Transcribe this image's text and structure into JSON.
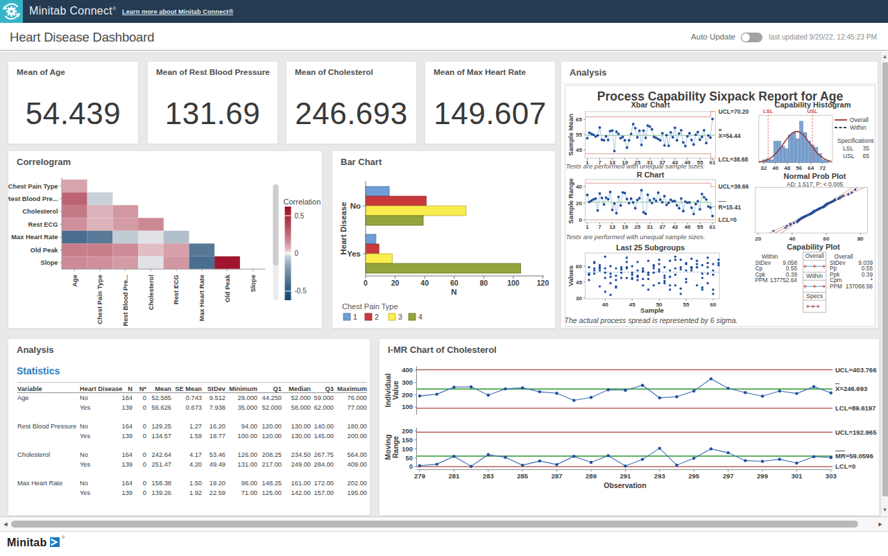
{
  "header": {
    "brand": "Minitab Connect",
    "brand_reg": "®",
    "link": "Learn more about Minitab Connect®",
    "brand_color": "#35b4c8",
    "nav_color": "#253b52"
  },
  "title_bar": {
    "title": "Heart Disease Dashboard",
    "auto_update_label": "Auto Update",
    "toggle_state": "off",
    "last_updated": "last updated 9/20/22, 12:45:23 PM"
  },
  "kpis": [
    {
      "label": "Mean of Age",
      "value": "54.439"
    },
    {
      "label": "Mean of Rest Blood Pressure",
      "value": "131.69"
    },
    {
      "label": "Mean of Cholesterol",
      "value": "246.693"
    },
    {
      "label": "Mean of Max Heart Rate",
      "value": "149.607"
    }
  ],
  "correlogram": {
    "title": "Correlogram",
    "type": "heatmap",
    "rows": [
      "Chest Pain Type",
      "Rest Blood Pre...",
      "Cholesterol",
      "Rest ECG",
      "Max Heart Rate",
      "Old Peak",
      "Slope"
    ],
    "cols": [
      "Age",
      "Chest Pain Type",
      "Rest Blood Pre...",
      "Cholesterol",
      "Rest ECG",
      "Max Heart Rate",
      "Old Peak",
      "Slope"
    ],
    "values": [
      [
        0.1
      ],
      [
        0.28,
        -0.04
      ],
      [
        0.21,
        0.07,
        0.13
      ],
      [
        0.15,
        0.07,
        0.12,
        0.17
      ],
      [
        -0.39,
        -0.33,
        -0.05,
        -0.01,
        -0.08
      ],
      [
        0.2,
        0.2,
        0.16,
        0.05,
        0.11,
        -0.34
      ],
      [
        0.16,
        0.15,
        0.12,
        -0.01,
        0.13,
        -0.39,
        0.58
      ]
    ],
    "legend_title": "Correlation",
    "legend_ticks": [
      0.5,
      0,
      -0.5
    ],
    "legend_range": [
      0.62,
      -0.62
    ],
    "color_positive": "#9c0c26",
    "color_negative": "#12446f",
    "color_zero": "#f4f1f1"
  },
  "bar_chart": {
    "title": "Bar Chart",
    "type": "bar",
    "orientation": "horizontal",
    "categories": [
      "No",
      "Yes"
    ],
    "series": [
      {
        "name": "1",
        "color": "#6f9ed6",
        "stroke": "#4a74ac",
        "values": [
          16,
          7
        ]
      },
      {
        "name": "2",
        "color": "#c9393b",
        "stroke": "#8f2a2c",
        "values": [
          41,
          9
        ]
      },
      {
        "name": "3",
        "color": "#f9ee4e",
        "stroke": "#bfae2f",
        "values": [
          68,
          18
        ]
      },
      {
        "name": "4",
        "color": "#94a43b",
        "stroke": "#687526",
        "values": [
          39,
          105
        ]
      }
    ],
    "xlabel": "N",
    "ylabel": "Heart Disease",
    "xlim": [
      0,
      120
    ],
    "xticks": [
      0,
      20,
      40,
      60,
      80,
      100,
      120
    ],
    "legend_title": "Chest Pain Type"
  },
  "sixpack": {
    "panel_title": "Analysis",
    "title": "Process Capability Sixpack Report for Age",
    "xbar": {
      "type": "line",
      "title": "Xbar Chart",
      "ylabel": "Sample Mean",
      "yticks": [
        45,
        55,
        65
      ],
      "xticks": [
        1,
        7,
        13,
        19,
        25,
        31,
        37,
        43,
        49,
        55,
        61
      ],
      "ucl_label": "UCL=70.20",
      "center_label": "X=54.44",
      "lcl_label": "LCL=38.68",
      "ucl_main": 66.55,
      "ucl_end": 70.2,
      "center": 54.44,
      "lcl_main": 42.33,
      "lcl_end": 38.68,
      "values": [
        52.6,
        56.2,
        55.4,
        54.8,
        53.6,
        54.4,
        59.6,
        51.6,
        51.2,
        53.8,
        51.4,
        57.2,
        57.6,
        44.2,
        56.8,
        55.4,
        52.6,
        53.4,
        51.2,
        46.4,
        51.2,
        55.4,
        61.8,
        59.2,
        53.2,
        57.4,
        48.2,
        57.6,
        52.8,
        60.8,
        60.2,
        58.4,
        53.4,
        52.8,
        52.0,
        51.2,
        55.8,
        47.8,
        54.6,
        47.6,
        56.4,
        53.2,
        59.4,
        51.2,
        55.6,
        57.8,
        49.8,
        47.4,
        53.8,
        55.8,
        51.4,
        48.4,
        54.8,
        56.6,
        51.6,
        53.4,
        57.8,
        49.4,
        54.4,
        53.0,
        65.2
      ]
    },
    "note1": "Tests are performed with unequal sample sizes.",
    "rchart": {
      "type": "line",
      "title": "R Chart",
      "ylabel": "Sample Range",
      "yticks": [
        0,
        20,
        40
      ],
      "xticks": [
        1,
        7,
        13,
        19,
        25,
        31,
        37,
        43,
        49,
        55,
        61
      ],
      "ucl_label": "UCL=39.66",
      "center_label": "R=15.41",
      "lcl_label": "LCL=0",
      "ucl_main": 44.04,
      "ucl_end": 39.66,
      "center_main": 21.07,
      "center_end": 15.41,
      "lcl": 0,
      "values": [
        29.8,
        21.4,
        23.0,
        24.4,
        25.4,
        11.2,
        31.6,
        26.2,
        18.4,
        26.6,
        24.6,
        33.4,
        11.8,
        19.4,
        7.9,
        27.4,
        17.2,
        32.8,
        32.2,
        25.0,
        19.9,
        25.4,
        20.8,
        13.9,
        23.8,
        25.8,
        35.4,
        9.0,
        7.2,
        30.0,
        23.4,
        20.2,
        25.2,
        22.6,
        32.6,
        24.2,
        21.0,
        28.4,
        18.0,
        20.4,
        24.0,
        22.2,
        22.6,
        17.4,
        13.8,
        25.6,
        10.4,
        21.8,
        20.6,
        21.0,
        14.4,
        7.0,
        19.0,
        22.4,
        12.6,
        31.0,
        27.0,
        24.4,
        16.0,
        14.6,
        4.4
      ]
    },
    "note2": "Tests are performed with unequal sample sizes.",
    "last25": {
      "type": "scatter",
      "title": "Last 25 Subgroups",
      "xlabel": "Sample",
      "ylabel": "Values",
      "yticks": [
        30,
        45,
        60
      ],
      "xticks": [
        40,
        45,
        50,
        55,
        60
      ],
      "mean_line": 54.4,
      "samples_start": 37,
      "values": [
        [
          59,
          53,
          52,
          52,
          47
        ],
        [
          64,
          63,
          58,
          56,
          53
        ],
        [
          61,
          59,
          58,
          56,
          41
        ],
        [
          69,
          58,
          54,
          49,
          36
        ],
        [
          60,
          53,
          50,
          44,
          33
        ],
        [
          58,
          51,
          47,
          41,
          40
        ],
        [
          59,
          57,
          57,
          54,
          49
        ],
        [
          68,
          64,
          59,
          58,
          49
        ],
        [
          60,
          54,
          52,
          49,
          48
        ],
        [
          64,
          56,
          51,
          50,
          47
        ],
        [
          58,
          56,
          55,
          48,
          42
        ],
        [
          65,
          54,
          52,
          48,
          38
        ],
        [
          61,
          60,
          58,
          54,
          42
        ],
        [
          66,
          62,
          57,
          55,
          44
        ],
        [
          59,
          51,
          49,
          46,
          44
        ],
        [
          65,
          56,
          50,
          42,
          38
        ],
        [
          69,
          66,
          58,
          52,
          42
        ],
        [
          66,
          59,
          57,
          39,
          34
        ],
        [
          63,
          62,
          56,
          48,
          45
        ],
        [
          67,
          59,
          59,
          58,
          56
        ],
        [
          65,
          62,
          59,
          59,
          42
        ],
        [
          61,
          53,
          49,
          40,
          38
        ],
        [
          68,
          63,
          59,
          53,
          44
        ],
        [
          62,
          56,
          52,
          38,
          34
        ],
        [
          66,
          63,
          61
        ]
      ]
    },
    "note3": "The actual process spread is represented by 6 sigma.",
    "histogram": {
      "type": "bar",
      "title": "Capability Histogram",
      "bin_start": 31.25,
      "bin_width": 2.5,
      "counts": [
        2,
        3,
        2,
        17,
        17,
        13,
        11,
        22,
        24,
        19,
        33,
        24,
        17,
        14,
        12,
        7,
        2,
        1
      ],
      "xticks": [
        32,
        40,
        48,
        56,
        64,
        72
      ],
      "lsl": 35,
      "usl": 65,
      "lsl_label": "LSL",
      "usl_label": "USL",
      "legend_overall": "Overall",
      "legend_within": "Within",
      "spec_title": "Specifications",
      "spec_lsl_label": "LSL",
      "spec_lsl_value": "35",
      "spec_usl_label": "USL",
      "spec_usl_value": "65",
      "curve_mean": 54.44,
      "curve_sd": 9.04
    },
    "probplot": {
      "type": "scatter",
      "title": "Normal Prob Plot",
      "subtitle": "AD: 1.517, P: < 0.005",
      "xticks": [
        20,
        40,
        60,
        80
      ],
      "fit_mean": 54.44,
      "fit_sd": 9.04,
      "points": [
        [
          29,
          -2.441
        ],
        [
          36,
          -2.074
        ],
        [
          37,
          -1.869
        ],
        [
          39,
          -1.722
        ],
        [
          39,
          -1.605
        ],
        [
          41,
          -1.506
        ],
        [
          43,
          -1.421
        ],
        [
          43,
          -1.344
        ],
        [
          43,
          -1.275
        ],
        [
          44,
          -1.211
        ],
        [
          44,
          -1.152
        ],
        [
          44,
          -1.097
        ],
        [
          45,
          -1.045
        ],
        [
          45,
          -0.995
        ],
        [
          45,
          -0.948
        ],
        [
          46,
          -0.903
        ],
        [
          46,
          -0.86
        ],
        [
          47,
          -0.818
        ],
        [
          47,
          -0.777
        ],
        [
          47,
          -0.738
        ],
        [
          48,
          -0.7
        ],
        [
          48,
          -0.663
        ],
        [
          49,
          -0.627
        ],
        [
          49,
          -0.591
        ],
        [
          49,
          -0.557
        ],
        [
          50,
          -0.523
        ],
        [
          50,
          -0.489
        ],
        [
          51,
          -0.456
        ],
        [
          51,
          -0.424
        ],
        [
          51,
          -0.392
        ],
        [
          51,
          -0.36
        ],
        [
          52,
          -0.329
        ],
        [
          52,
          -0.298
        ],
        [
          52,
          -0.268
        ],
        [
          52,
          -0.237
        ],
        [
          52,
          -0.207
        ],
        [
          53,
          -0.177
        ],
        [
          53,
          -0.148
        ],
        [
          53,
          -0.118
        ],
        [
          53,
          -0.088
        ],
        [
          53,
          -0.059
        ],
        [
          54,
          -0.029
        ],
        [
          54,
          0.0
        ],
        [
          55,
          0.029
        ],
        [
          55,
          0.059
        ],
        [
          55,
          0.088
        ],
        [
          55,
          0.118
        ],
        [
          56,
          0.148
        ],
        [
          56,
          0.177
        ],
        [
          56,
          0.207
        ],
        [
          56,
          0.237
        ],
        [
          57,
          0.268
        ],
        [
          57,
          0.298
        ],
        [
          58,
          0.329
        ],
        [
          58,
          0.36
        ],
        [
          58,
          0.392
        ],
        [
          59,
          0.424
        ],
        [
          59,
          0.456
        ],
        [
          59,
          0.489
        ],
        [
          59,
          0.523
        ],
        [
          59,
          0.557
        ],
        [
          60,
          0.591
        ],
        [
          60,
          0.627
        ],
        [
          60,
          0.663
        ],
        [
          60,
          0.7
        ],
        [
          60,
          0.738
        ],
        [
          61,
          0.777
        ],
        [
          61,
          0.818
        ],
        [
          62,
          0.86
        ],
        [
          62,
          0.903
        ],
        [
          63,
          0.948
        ],
        [
          63,
          0.995
        ],
        [
          64,
          1.045
        ],
        [
          64,
          1.097
        ],
        [
          65,
          1.152
        ],
        [
          65,
          1.211
        ],
        [
          65,
          1.275
        ],
        [
          67,
          1.344
        ],
        [
          68,
          1.421
        ],
        [
          68,
          1.506
        ],
        [
          69,
          1.605
        ],
        [
          70,
          1.722
        ],
        [
          73,
          1.869
        ],
        [
          75,
          2.074
        ],
        [
          77,
          2.441
        ]
      ]
    },
    "capplot": {
      "title": "Capability Plot",
      "sections": [
        "Overall",
        "Within",
        "Specs"
      ],
      "within_header": "Within",
      "within_stats": [
        [
          "StDev",
          "9.058"
        ],
        [
          "Cp",
          "0.55"
        ],
        [
          "Cpk",
          "0.39"
        ],
        [
          "PPM",
          "137752.64"
        ]
      ],
      "overall_header": "Overall",
      "overall_stats": [
        [
          "StDev",
          "9.039"
        ],
        [
          "Pp",
          "0.55"
        ],
        [
          "Ppk",
          "0.39"
        ],
        [
          "Cpm",
          "*"
        ],
        [
          "PPM",
          "137068.58"
        ]
      ],
      "overall_span": [
        27.3,
        81.6
      ],
      "within_span": [
        27.3,
        81.6
      ],
      "specs_span": [
        35,
        65
      ],
      "scale": [
        26,
        83
      ]
    }
  },
  "statistics": {
    "panel_title": "Analysis",
    "section_title": "Statistics",
    "type": "table",
    "columns": [
      "Variable",
      "Heart Disease",
      "N",
      "N*",
      "Mean",
      "SE Mean",
      "StDev",
      "Minimum",
      "Q1",
      "Median",
      "Q3",
      "Maximum"
    ],
    "rows": [
      [
        "Age",
        "No",
        "164",
        "0",
        "52.585",
        "0.743",
        "9.512",
        "29.000",
        "44.250",
        "52.000",
        "59.000",
        "76.000"
      ],
      [
        "",
        "Yes",
        "139",
        "0",
        "56.626",
        "0.673",
        "7.938",
        "35.000",
        "52.000",
        "58.000",
        "62.000",
        "77.000"
      ],
      [
        "Rest Blood Pressure",
        "No",
        "164",
        "0",
        "129.25",
        "1.27",
        "16.20",
        "94.00",
        "120.00",
        "130.00",
        "140.00",
        "180.00"
      ],
      [
        "",
        "Yes",
        "139",
        "0",
        "134.57",
        "1.59",
        "18.77",
        "100.00",
        "120.00",
        "130.00",
        "145.00",
        "200.00"
      ],
      [
        "Cholesterol",
        "No",
        "164",
        "0",
        "242.64",
        "4.17",
        "53.46",
        "126.00",
        "208.25",
        "234.50",
        "267.75",
        "564.00"
      ],
      [
        "",
        "Yes",
        "139",
        "0",
        "251.47",
        "4.20",
        "49.49",
        "131.00",
        "217.00",
        "249.00",
        "284.00",
        "409.00"
      ],
      [
        "Max Heart Rate",
        "No",
        "164",
        "0",
        "158.38",
        "1.50",
        "19.20",
        "96.00",
        "148.25",
        "161.00",
        "172.00",
        "202.00"
      ],
      [
        "",
        "Yes",
        "139",
        "0",
        "139.26",
        "1.92",
        "22.59",
        "71.00",
        "125.00",
        "142.00",
        "157.00",
        "195.00"
      ]
    ]
  },
  "imr": {
    "panel_title": "I-MR Chart of Cholesterol",
    "type": "line",
    "individual": {
      "ylabel_lines": [
        "Individual",
        "Value"
      ],
      "yticks": [
        400,
        300,
        200,
        100
      ],
      "ucl": 403.766,
      "center": 246.693,
      "lcl": 89.6197,
      "ucl_label": "UCL=403.766",
      "center_label": "X=246.693",
      "lcl_label": "LCL=89.6197",
      "values": [
        190,
        204,
        262,
        264,
        196,
        248,
        256,
        224,
        212,
        154,
        178,
        240,
        236,
        277,
        174,
        183,
        230,
        330,
        252,
        218,
        188,
        230,
        210,
        266,
        215
      ]
    },
    "moving_range": {
      "ylabel_lines": [
        "Moving",
        "Range"
      ],
      "yticks": [
        200,
        150,
        100,
        50,
        0
      ],
      "ucl": 192.965,
      "center": 59.0596,
      "lcl": 0,
      "ucl_label": "UCL=192.965",
      "center_label": "MR=59.0596",
      "lcl_label": "LCL=0",
      "first_mr": 6
    },
    "obs_start": 279,
    "xticks": [
      279,
      281,
      283,
      285,
      287,
      289,
      291,
      293,
      295,
      297,
      299,
      301,
      303
    ],
    "xlabel": "Observation"
  },
  "footer": {
    "brand": "Minitab",
    "reg": "®",
    "logo_color": "#1878be"
  },
  "colors": {
    "point_blue": "#1f4e9c",
    "line_blue": "#9cc0e4",
    "limit_red_light": "#dd9a96",
    "limit_red_dark": "#a94442",
    "center_green_light": "#88c188",
    "center_green_dark": "#4aa44a",
    "hist_fill": "#7fa5d3",
    "hist_stroke": "#5a7aa6",
    "overall_curve": "#9c3734",
    "plot_border": "#c9c9c9",
    "tick_text": "#3c3c3c"
  }
}
